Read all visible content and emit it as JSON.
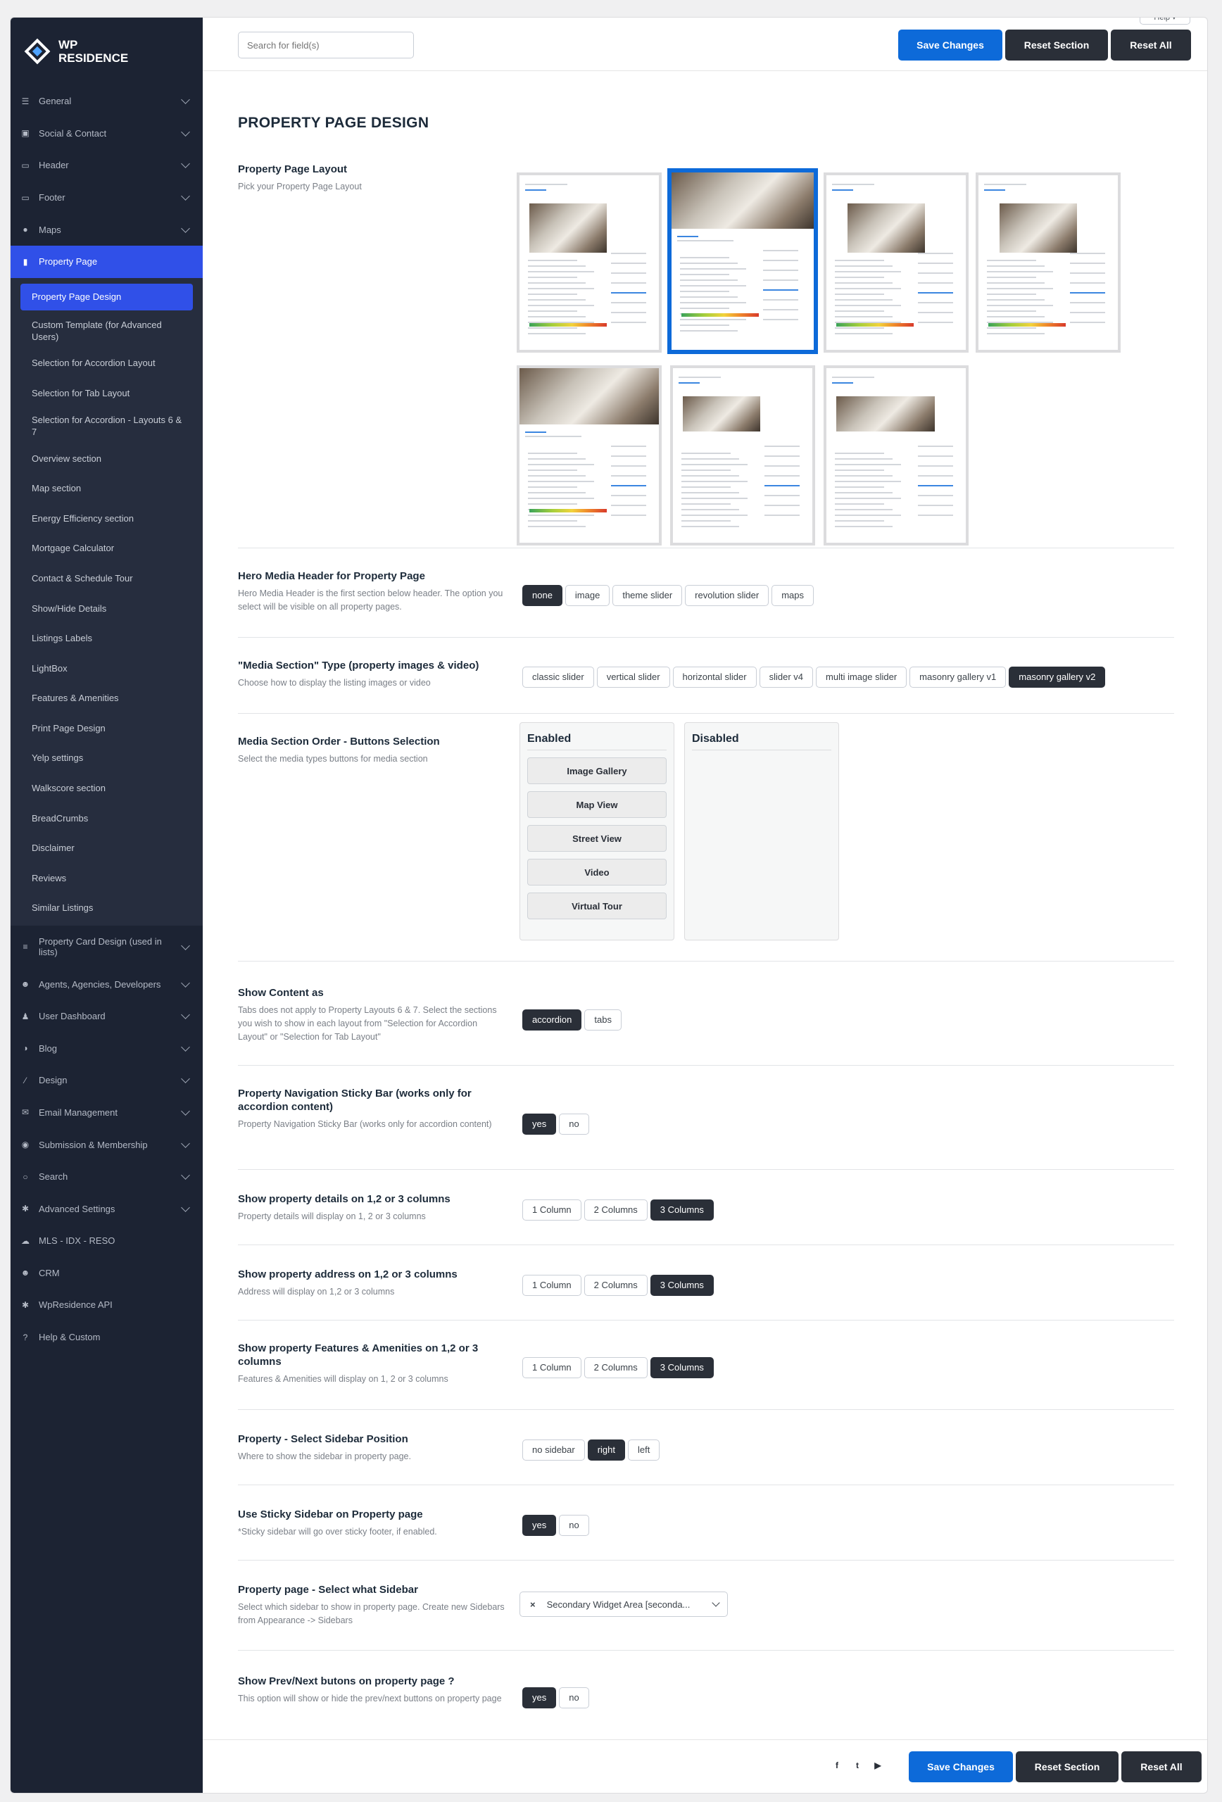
{
  "app": {
    "logo_line1": "WP",
    "logo_line2": "RESIDENCE",
    "help": "Help ▾"
  },
  "sidebar": {
    "top_items": [
      {
        "label": "General",
        "icon": "sliders-icon"
      },
      {
        "label": "Social & Contact",
        "icon": "contact-card-icon"
      },
      {
        "label": "Header",
        "icon": "monitor-icon"
      },
      {
        "label": "Footer",
        "icon": "desktop-icon"
      },
      {
        "label": "Maps",
        "icon": "map-pin-icon"
      }
    ],
    "active_item": {
      "label": "Property Page",
      "icon": "document-icon"
    },
    "sub_items": [
      "Property Page Design",
      "Custom Template (for Advanced Users)",
      "Selection for Accordion Layout",
      "Selection for Tab Layout",
      "Selection for Accordion - Layouts 6 & 7",
      "Overview section",
      "Map section",
      "Energy Efficiency section",
      "Mortgage Calculator",
      "Contact & Schedule Tour",
      "Show/Hide Details",
      "Listings Labels",
      "LightBox",
      "Features & Amenities",
      "Print Page Design",
      "Yelp settings",
      "Walkscore section",
      "BreadCrumbs",
      "Disclaimer",
      "Reviews",
      "Similar Listings"
    ],
    "bottom_items": [
      {
        "label": "Property Card Design (used in lists)",
        "icon": "list-icon",
        "chevron": true
      },
      {
        "label": "Agents, Agencies, Developers",
        "icon": "users-icon",
        "chevron": true
      },
      {
        "label": "User Dashboard",
        "icon": "user-icon",
        "chevron": true
      },
      {
        "label": "Blog",
        "icon": "blog-icon",
        "chevron": true
      },
      {
        "label": "Design",
        "icon": "brush-icon",
        "chevron": true
      },
      {
        "label": "Email Management",
        "icon": "email-icon",
        "chevron": true
      },
      {
        "label": "Submission & Membership",
        "icon": "membership-icon",
        "chevron": true
      },
      {
        "label": "Search",
        "icon": "search-icon",
        "chevron": true
      },
      {
        "label": "Advanced Settings",
        "icon": "gear-icon",
        "chevron": true
      },
      {
        "label": "MLS - IDX - RESO",
        "icon": "cloud-icon",
        "chevron": false
      },
      {
        "label": "CRM",
        "icon": "crm-icon",
        "chevron": false
      },
      {
        "label": "WpResidence API",
        "icon": "api-gear-icon",
        "chevron": false
      },
      {
        "label": "Help & Custom",
        "icon": "question-icon",
        "chevron": false
      }
    ]
  },
  "toolbar": {
    "search_placeholder": "Search for field(s)",
    "save": "Save Changes",
    "reset_section": "Reset Section",
    "reset_all": "Reset All"
  },
  "page": {
    "title": "PROPERTY PAGE DESIGN",
    "layout": {
      "title": "Property Page Layout",
      "desc": "Pick your Property Page Layout",
      "selected_index": 1,
      "count": 7
    },
    "hero": {
      "title": "Hero Media Header for Property Page",
      "desc": "Hero Media Header is the first section below header. The option you select will be visible on all property pages.",
      "options": [
        "none",
        "image",
        "theme slider",
        "revolution slider",
        "maps"
      ],
      "selected": 0
    },
    "media_type": {
      "title": "\"Media Section\" Type (property images & video)",
      "desc": "Choose how to display the listing images or video",
      "options": [
        "classic slider",
        "vertical slider",
        "horizontal slider",
        "slider v4",
        "multi image slider",
        "masonry gallery v1",
        "masonry gallery v2"
      ],
      "selected": 6
    },
    "media_order": {
      "title": "Media Section Order - Buttons Selection",
      "desc": "Select the media types buttons for media section",
      "enabled_label": "Enabled",
      "disabled_label": "Disabled",
      "enabled": [
        "Image Gallery",
        "Map View",
        "Street View",
        "Video",
        "Virtual Tour"
      ]
    },
    "show_content": {
      "title": "Show Content as",
      "desc": "Tabs does not apply to Property Layouts 6 & 7. Select the sections you wish to show in each layout from \"Selection for Accordion Layout\" or \"Selection for Tab Layout\"",
      "options": [
        "accordion",
        "tabs"
      ],
      "selected": 0
    },
    "sticky_bar": {
      "title": "Property Navigation Sticky Bar (works only for accordion content)",
      "desc": "Property Navigation Sticky Bar (works only for accordion content)",
      "options": [
        "yes",
        "no"
      ],
      "selected": 0
    },
    "details_cols": {
      "title": "Show property details on 1,2 or 3 columns",
      "desc": "Property details will display on 1, 2 or 3 columns",
      "options": [
        "1 Column",
        "2 Columns",
        "3 Columns"
      ],
      "selected": 2
    },
    "address_cols": {
      "title": "Show property address on 1,2 or 3 columns",
      "desc": "Address will display on 1,2 or 3 columns",
      "options": [
        "1 Column",
        "2 Columns",
        "3 Columns"
      ],
      "selected": 2
    },
    "features_cols": {
      "title": "Show property Features & Amenities on 1,2 or 3 columns",
      "desc": "Features & Amenities will display on 1, 2 or 3 columns",
      "options": [
        "1 Column",
        "2 Columns",
        "3 Columns"
      ],
      "selected": 2
    },
    "sidebar_pos": {
      "title": "Property - Select Sidebar Position",
      "desc": "Where to show the sidebar in property page.",
      "options": [
        "no sidebar",
        "right",
        "left"
      ],
      "selected": 1
    },
    "sticky_sidebar": {
      "title": "Use Sticky Sidebar on Property page",
      "desc": "*Sticky sidebar will go over sticky footer, if enabled.",
      "options": [
        "yes",
        "no"
      ],
      "selected": 0
    },
    "which_sidebar": {
      "title": "Property page - Select what Sidebar",
      "desc": "Select which sidebar to show in property page. Create new Sidebars from Appearance -> Sidebars",
      "value": "Secondary Widget Area [seconda...",
      "clear": "×"
    },
    "prev_next": {
      "title": "Show Prev/Next butons on property page ?",
      "desc": "This option will show or hide the prev/next buttons on property page",
      "options": [
        "yes",
        "no"
      ],
      "selected": 0
    }
  },
  "footer": {
    "social": [
      {
        "icon": "facebook-icon",
        "glyph": "f"
      },
      {
        "icon": "twitter-icon",
        "glyph": "t"
      },
      {
        "icon": "youtube-icon",
        "glyph": "▶"
      }
    ]
  },
  "colors": {
    "sidebar_bg": "#1c2333",
    "accent_blue": "#0d6ad9",
    "active_nav": "#3050e8",
    "dark_button": "#2a2f38"
  }
}
